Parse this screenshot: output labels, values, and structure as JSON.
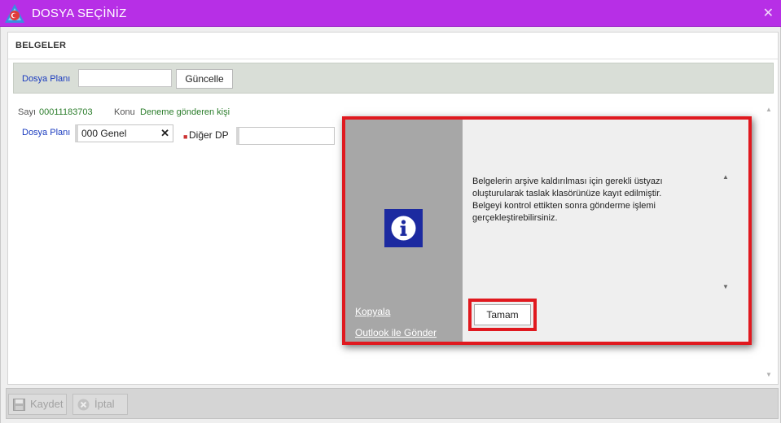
{
  "window": {
    "title": "DOSYA SEÇİNİZ",
    "title_bar_color": "#b72fe6"
  },
  "panel": {
    "header": "BELGELER"
  },
  "filter": {
    "dosya_plani_label": "Dosya Planı",
    "dosya_plani_value": "",
    "update_button": "Güncelle"
  },
  "document": {
    "sayi_label": "Sayı",
    "sayi_value": "00011183703",
    "konu_label": "Konu",
    "konu_value": "Deneme gönderen kişi",
    "dosya_plani_label": "Dosya Planı",
    "dosya_plani_value": "000 Genel",
    "diger_dp_label": "Diğer DP",
    "diger_dp_value": ""
  },
  "footer": {
    "save_label": "Kaydet",
    "cancel_label": "İptal"
  },
  "dialog": {
    "icon": "info-icon",
    "message_lines": [
      "Belgelerin arşive kaldırılması için gerekli üstyazı",
      "oluşturularak taslak klasörünüze kayıt edilmiştir.",
      "Belgeyi kontrol ettikten sonra gönderme işlemi",
      "gerçekleştirebilirsiniz."
    ],
    "copy_link": "Kopyala",
    "outlook_link": "Outlook ile Gönder",
    "ok_button": "Tamam",
    "highlight_color": "#e0191f",
    "icon_color": "#1c2aa0"
  }
}
